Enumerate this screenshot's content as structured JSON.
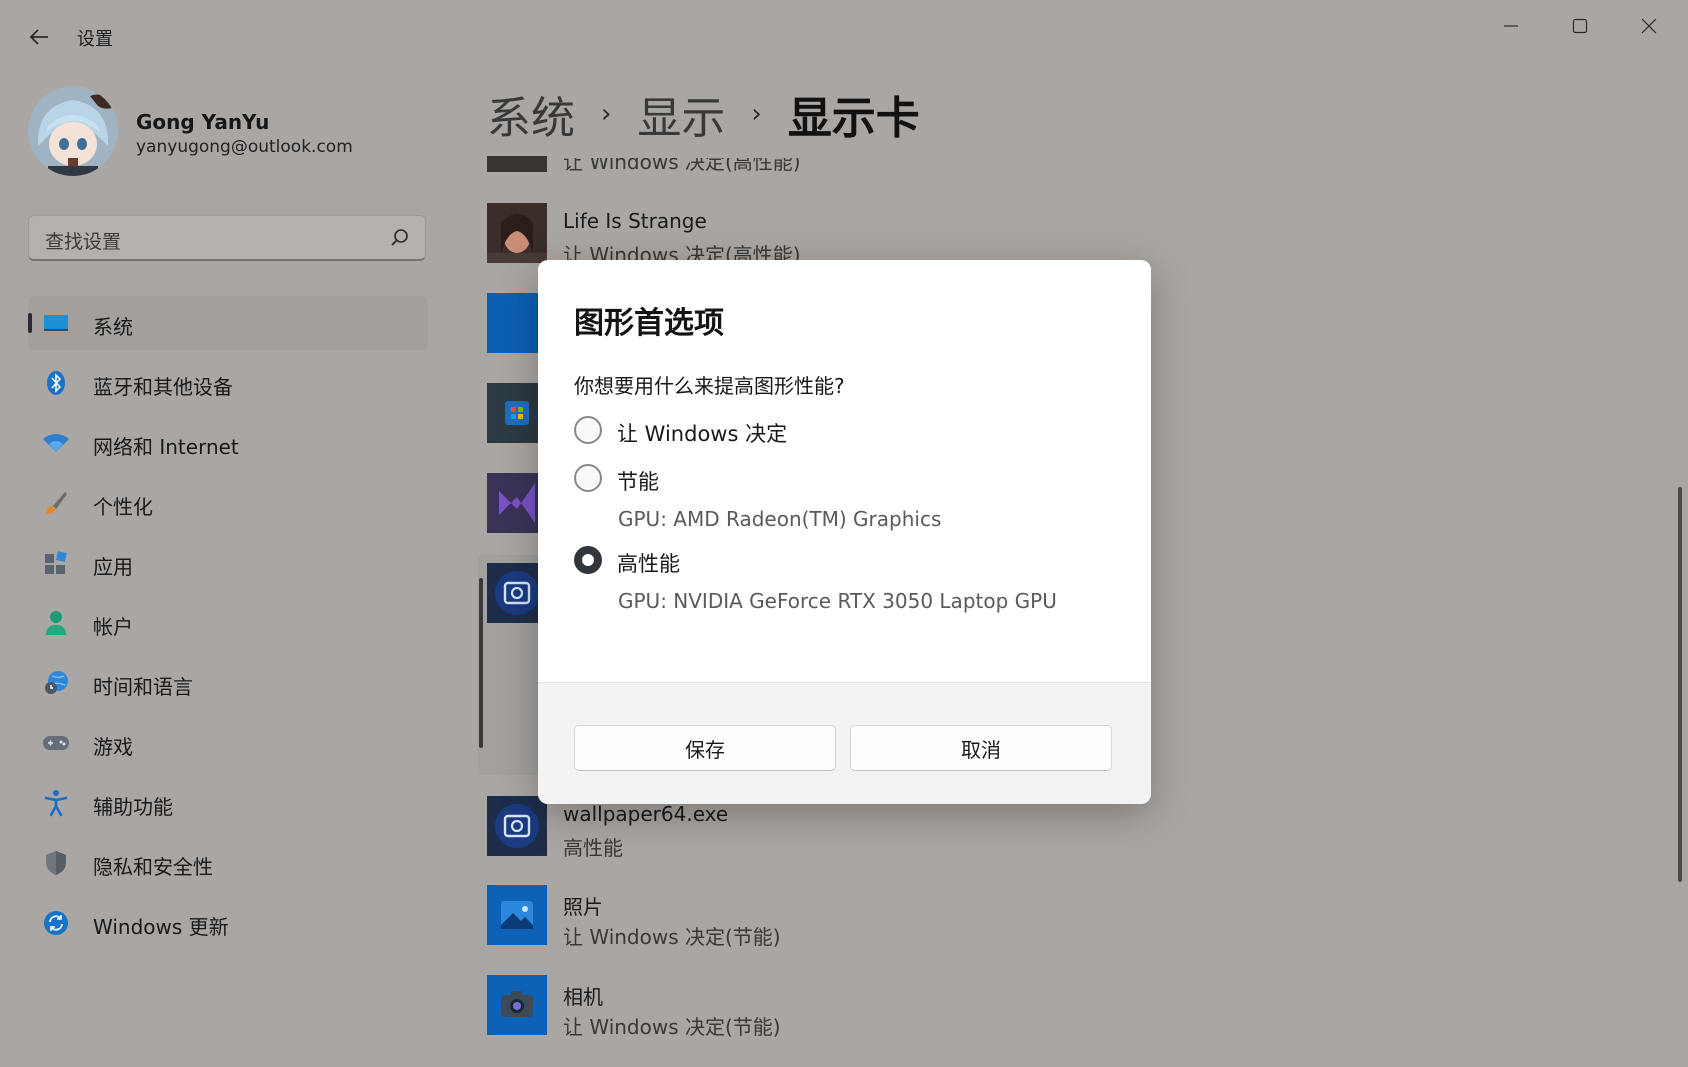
{
  "window": {
    "app_title": "设置"
  },
  "profile": {
    "name": "Gong YanYu",
    "email": "yanyugong@outlook.com"
  },
  "search": {
    "placeholder": "查找设置"
  },
  "nav": {
    "items": [
      {
        "label": "系统",
        "icon": "monitor-icon",
        "selected": true
      },
      {
        "label": "蓝牙和其他设备",
        "icon": "bluetooth-icon"
      },
      {
        "label": "网络和 Internet",
        "icon": "wifi-icon"
      },
      {
        "label": "个性化",
        "icon": "brush-icon"
      },
      {
        "label": "应用",
        "icon": "apps-icon"
      },
      {
        "label": "帐户",
        "icon": "person-icon"
      },
      {
        "label": "时间和语言",
        "icon": "globe-clock-icon"
      },
      {
        "label": "游戏",
        "icon": "gamepad-icon"
      },
      {
        "label": "辅助功能",
        "icon": "accessibility-icon"
      },
      {
        "label": "隐私和安全性",
        "icon": "shield-icon"
      },
      {
        "label": "Windows 更新",
        "icon": "update-icon"
      }
    ]
  },
  "breadcrumb": {
    "items": [
      "系统",
      "显示"
    ],
    "current": "显示卡"
  },
  "apps": [
    {
      "name": "",
      "pref": "让 Windows 决定(高性能)"
    },
    {
      "name": "Life Is Strange",
      "pref": "让 Windows 决定(高性能)"
    },
    {
      "name": "wallpaper64.exe",
      "pref": "高性能"
    },
    {
      "name": "照片",
      "pref": "让 Windows 决定(节能)"
    },
    {
      "name": "相机",
      "pref": "让 Windows 决定(节能)"
    }
  ],
  "dialog": {
    "title": "图形首选项",
    "question": "你想要用什么来提高图形性能?",
    "options": [
      {
        "label": "让 Windows 决定",
        "checked": false
      },
      {
        "label": "节能",
        "sub": "GPU: AMD Radeon(TM) Graphics",
        "checked": false
      },
      {
        "label": "高性能",
        "sub": "GPU: NVIDIA GeForce RTX 3050 Laptop GPU",
        "checked": true
      }
    ],
    "save_label": "保存",
    "cancel_label": "取消"
  },
  "colors": {
    "accent": "#0067c0",
    "window_bg": "#aaa6a3",
    "dialog_bg": "#ffffff",
    "footer_bg": "#f3f3f3"
  }
}
